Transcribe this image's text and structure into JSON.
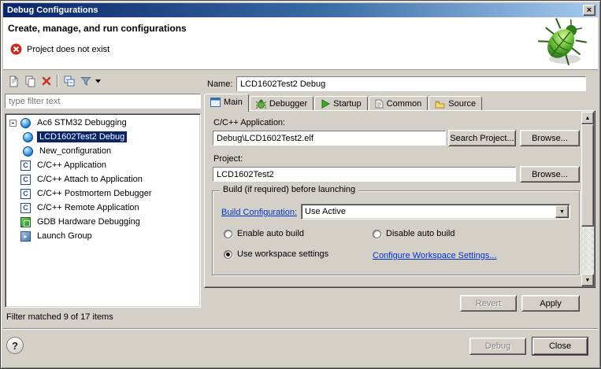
{
  "window": {
    "title": "Debug Configurations"
  },
  "icons": {
    "close": "×",
    "combo_dropdown": "▼",
    "scroll_up": "▲",
    "scroll_down": "▼",
    "help": "?"
  },
  "header": {
    "title": "Create, manage, and run configurations",
    "error_message": "Project does not exist"
  },
  "left_panel": {
    "filter_text": "type filter text",
    "tree_items": [
      {
        "label": "Ac6 STM32 Debugging",
        "level": 0,
        "expanded": true,
        "selected": false
      },
      {
        "label": "LCD1602Test2 Debug",
        "level": 1,
        "selected": true
      },
      {
        "label": "New_configuration",
        "level": 1,
        "selected": false
      },
      {
        "label": "C/C++ Application",
        "level": 0,
        "selected": false
      },
      {
        "label": "C/C++ Attach to Application",
        "level": 0,
        "selected": false
      },
      {
        "label": "C/C++ Postmortem Debugger",
        "level": 0,
        "selected": false
      },
      {
        "label": "C/C++ Remote Application",
        "level": 0,
        "selected": false
      },
      {
        "label": "GDB Hardware Debugging",
        "level": 0,
        "selected": false
      },
      {
        "label": "Launch Group",
        "level": 0,
        "selected": false
      }
    ],
    "status": "Filter matched 9 of 17 items"
  },
  "form": {
    "name_label": "Name:",
    "name_value": "LCD1602Test2 Debug",
    "tabs": [
      {
        "label": "Main",
        "selected": true
      },
      {
        "label": "Debugger",
        "selected": false
      },
      {
        "label": "Startup",
        "selected": false
      },
      {
        "label": "Common",
        "selected": false
      },
      {
        "label": "Source",
        "selected": false
      }
    ],
    "main_tab": {
      "application_label": "C/C++ Application:",
      "application_value": "Debug\\LCD1602Test2.elf",
      "search_project_button": "Search Project...",
      "browse_button": "Browse...",
      "project_label": "Project:",
      "project_value": "LCD1602Test2",
      "project_browse_button": "Browse...",
      "build_group": {
        "title": "Build (if required) before launching",
        "build_configuration_link": "Build Configuration:",
        "build_configuration_value": "Use Active",
        "enable_auto_build": {
          "label": "Enable auto build",
          "checked": false
        },
        "disable_auto_build": {
          "label": "Disable auto build",
          "checked": false
        },
        "use_workspace_settings": {
          "label": "Use workspace settings",
          "checked": true
        },
        "configure_workspace_link": "Configure Workspace Settings..."
      }
    },
    "revert_button": {
      "label": "Revert",
      "enabled": false
    },
    "apply_button": {
      "label": "Apply",
      "enabled": true
    }
  },
  "footer": {
    "debug_button": {
      "label": "Debug",
      "enabled": false
    },
    "close_button": {
      "label": "Close",
      "enabled": true
    }
  }
}
